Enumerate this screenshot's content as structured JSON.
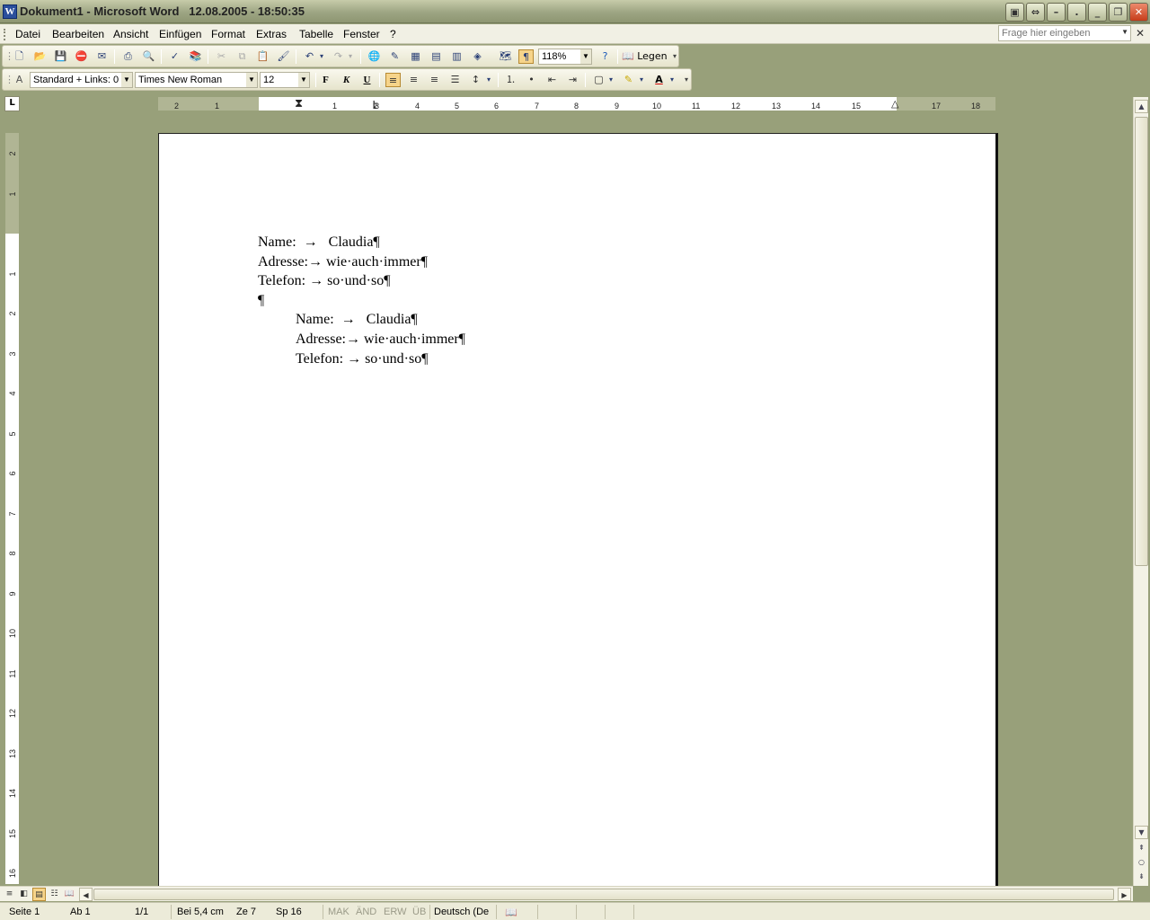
{
  "window": {
    "title": "Dokument1 - Microsoft Word   12.08.2005 - 18:50:35",
    "app_icon": "W"
  },
  "menu": {
    "items": [
      "Datei",
      "Bearbeiten",
      "Ansicht",
      "Einfügen",
      "Format",
      "Extras",
      "Tabelle",
      "Fenster",
      "?"
    ],
    "help_placeholder": "Frage hier eingeben"
  },
  "toolbar": {
    "zoom": "118%",
    "read_label": "Legen"
  },
  "format_toolbar": {
    "style": "Standard + Links: 0",
    "font": "Times New Roman",
    "size": "12",
    "bold": "F",
    "italic": "K",
    "underline": "U"
  },
  "ruler": {
    "h_ticks": [
      "2",
      "1",
      "1",
      "2",
      "3",
      "4",
      "5",
      "6",
      "7",
      "8",
      "9",
      "10",
      "11",
      "12",
      "13",
      "14",
      "15",
      "16",
      "17",
      "18"
    ],
    "v_ticks": [
      "2",
      "1",
      "1",
      "2",
      "3",
      "4",
      "5",
      "6",
      "7",
      "8",
      "9",
      "10",
      "11",
      "12",
      "13",
      "14",
      "15",
      "16"
    ]
  },
  "document": {
    "lines": [
      "Name:  →   Claudia¶",
      "Adresse:→ wie·auch·immer¶",
      "Telefon: → so·und·so¶",
      "¶",
      "Name:  →   Claudia¶",
      "Adresse:→ wie·auch·immer¶",
      "Telefon: → so·und·so¶"
    ]
  },
  "status": {
    "page": "Seite  1",
    "section": "Ab  1",
    "pages": "1/1",
    "position": "Bei 5,4 cm",
    "line": "Ze  7",
    "column": "Sp  16",
    "mak": "MAK",
    "and": "ÄND",
    "erw": "ERW",
    "ub": "ÜB",
    "language": "Deutsch (De"
  }
}
